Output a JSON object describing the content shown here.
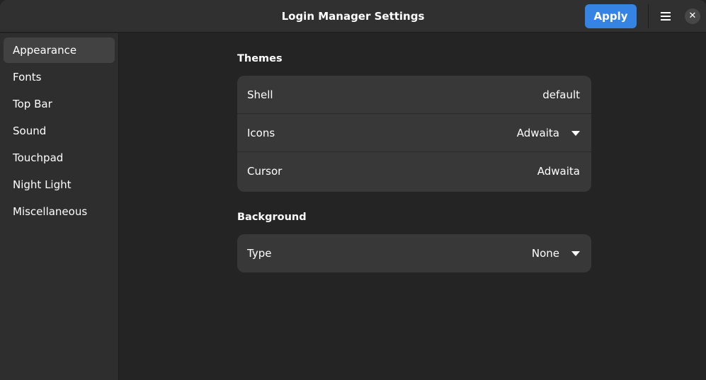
{
  "window": {
    "title": "Login Manager Settings",
    "apply_label": "Apply",
    "menu_icon": "hamburger-menu-icon",
    "close_icon": "close-icon",
    "close_glyph": "✕"
  },
  "sidebar": {
    "items": [
      {
        "label": "Appearance",
        "active": true
      },
      {
        "label": "Fonts"
      },
      {
        "label": "Top Bar"
      },
      {
        "label": "Sound"
      },
      {
        "label": "Touchpad"
      },
      {
        "label": "Night Light"
      },
      {
        "label": "Miscellaneous"
      }
    ]
  },
  "main": {
    "themes": {
      "title": "Themes",
      "rows": [
        {
          "label": "Shell",
          "value": "default"
        },
        {
          "label": "Icons",
          "value": "Adwaita",
          "dropdown": true
        },
        {
          "label": "Cursor",
          "value": "Adwaita"
        }
      ]
    },
    "background": {
      "title": "Background",
      "rows": [
        {
          "label": "Type",
          "value": "None",
          "dropdown": true
        }
      ]
    }
  },
  "colors": {
    "accent": "#3584e4",
    "window_bg": "#242424",
    "sidebar_bg": "#2e2e2e",
    "card_bg": "#383838",
    "header_bg": "#303030"
  }
}
